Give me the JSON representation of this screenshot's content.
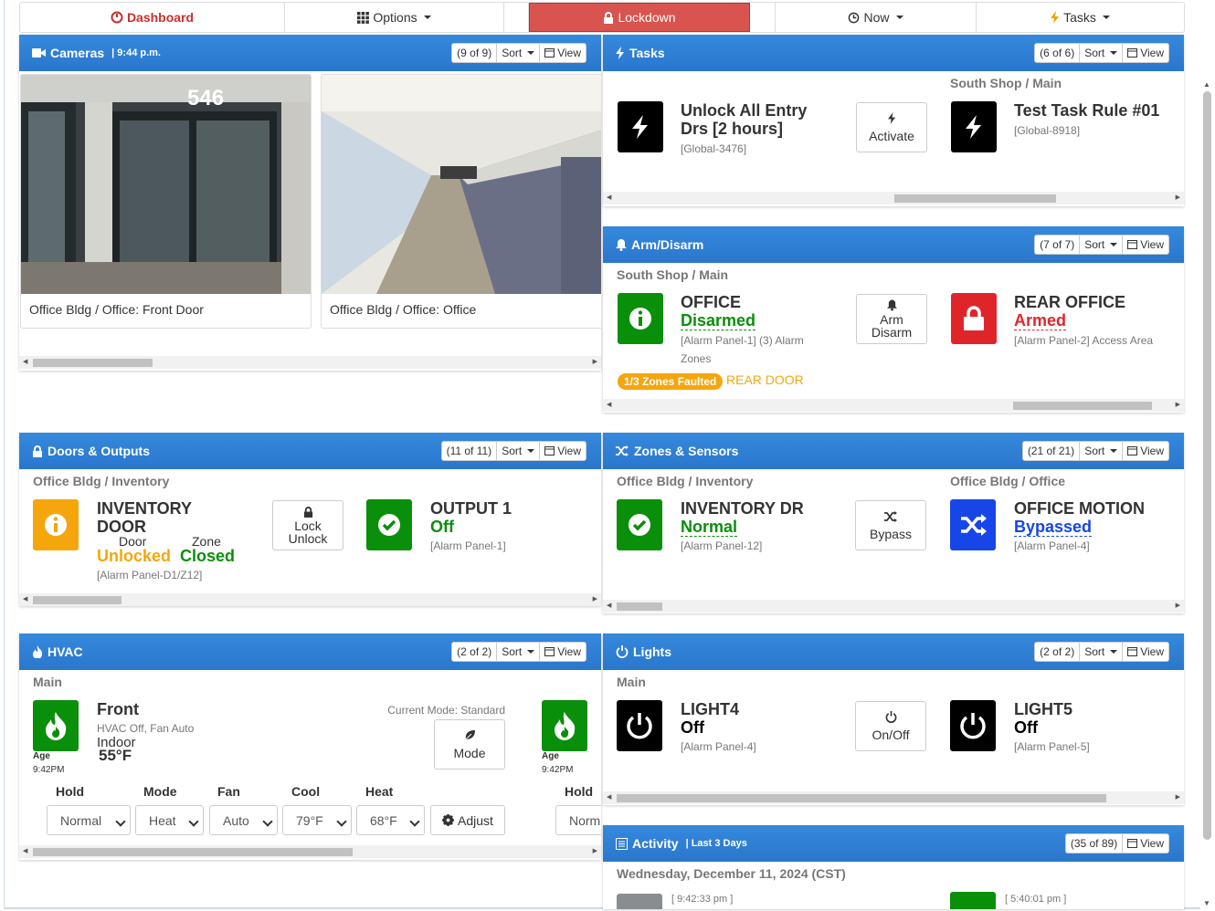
{
  "nav": {
    "dashboard": "Dashboard",
    "options": "Options",
    "lockdown": "Lockdown",
    "now": "Now",
    "tasks": "Tasks"
  },
  "common": {
    "sort": "Sort",
    "view": "View"
  },
  "cameras": {
    "title": "Cameras",
    "time": "| 9:44 p.m.",
    "count": "(9 of 9)",
    "items": [
      {
        "caption": "Office Bldg / Office: Front Door",
        "door_number": "546"
      },
      {
        "caption": "Office Bldg / Office: Office"
      }
    ]
  },
  "tasks": {
    "title": "Tasks",
    "count": "(6 of 6)",
    "location2": "South Shop / Main",
    "items": [
      {
        "name": "Unlock All Entry Drs [2 hours]",
        "id": "[Global-3476]",
        "button": "Activate"
      },
      {
        "name": "Test Task Rule #01",
        "id": "[Global-8918]"
      }
    ]
  },
  "arm": {
    "title": "Arm/Disarm",
    "count": "(7 of 7)",
    "location": "South Shop / Main",
    "items": [
      {
        "name": "OFFICE",
        "status": "Disarmed",
        "detail": "[Alarm Panel-1] (3) Alarm Zones",
        "button1": "Arm",
        "button2": "Disarm"
      },
      {
        "name": "REAR OFFICE",
        "status": "Armed",
        "detail": "[Alarm Panel-2] Access Area"
      }
    ],
    "faulted_badge": "1/3 Zones Faulted",
    "faulted_zone": "REAR DOOR"
  },
  "doors": {
    "title": "Doors & Outputs",
    "count": "(11 of 11)",
    "location": "Office Bldg / Inventory",
    "items": [
      {
        "name": "INVENTORY DOOR",
        "door_label": "Door",
        "zone_label": "Zone",
        "door_status": "Unlocked",
        "zone_status": "Closed",
        "detail": "[Alarm Panel-D1/Z12]",
        "button1": "Lock",
        "button2": "Unlock"
      },
      {
        "name": "OUTPUT 1",
        "status": "Off",
        "detail": "[Alarm Panel-1]"
      }
    ]
  },
  "zones": {
    "title": "Zones & Sensors",
    "count": "(21 of 21)",
    "location": "Office Bldg / Inventory",
    "location2": "Office Bldg / Office",
    "items": [
      {
        "name": "INVENTORY DR",
        "status": "Normal",
        "detail": "[Alarm Panel-12]",
        "button": "Bypass"
      },
      {
        "name": "OFFICE MOTION",
        "status": "Bypassed",
        "detail": "[Alarm Panel-4]"
      }
    ]
  },
  "hvac": {
    "title": "HVAC",
    "count": "(2 of 2)",
    "location": "Main",
    "name": "Front",
    "detail": "HVAC Off, Fan Auto",
    "indoor_label": "Indoor",
    "indoor_temp": "55°F",
    "mode_text": "Current Mode: Standard",
    "mode_button": "Mode",
    "age_label": "Age",
    "age_time": "9:42PM",
    "age_label2": "Age",
    "age_time2": "9:42PM",
    "labels": {
      "hold": "Hold",
      "mode": "Mode",
      "fan": "Fan",
      "cool": "Cool",
      "heat": "Heat",
      "hold2": "Hold"
    },
    "values": {
      "hold": "Normal",
      "mode": "Heat",
      "fan": "Auto",
      "cool": "79°F",
      "heat": "68°F",
      "hold2": "Norm"
    },
    "adjust": "Adjust"
  },
  "lights": {
    "title": "Lights",
    "count": "(2 of 2)",
    "location": "Main",
    "items": [
      {
        "name": "LIGHT4",
        "status": "Off",
        "detail": "[Alarm Panel-4]",
        "button": "On/Off"
      },
      {
        "name": "LIGHT5",
        "status": "Off",
        "detail": "[Alarm Panel-5]"
      }
    ]
  },
  "activity": {
    "title": "Activity",
    "sub": "| Last 3 Days",
    "count": "(35 of 89)",
    "date": "Wednesday, December 11, 2024 (CST)",
    "time1": "[ 9:42:33 pm ]",
    "time2": "[ 5:40:01 pm ]"
  },
  "colors": {
    "header": "#2f7fd3",
    "green": "#0a8f0a",
    "red": "#e0252a",
    "orange": "#f5a60c",
    "blue": "#1646e8",
    "black": "#000000"
  }
}
